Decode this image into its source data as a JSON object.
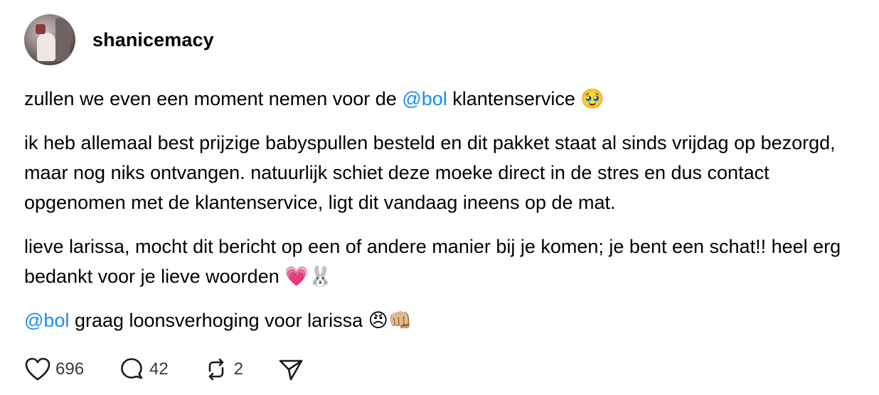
{
  "post": {
    "username": "shanicemacy",
    "paragraphs": [
      {
        "segments": [
          {
            "text": "zullen we even een moment nemen voor de ",
            "mention": false
          },
          {
            "text": "@bol",
            "mention": true
          },
          {
            "text": " klantenservice 🥹",
            "mention": false
          }
        ]
      },
      {
        "segments": [
          {
            "text": "ik heb allemaal best prijzige babyspullen besteld en dit pakket staat al sinds vrijdag op bezorgd, maar nog niks ontvangen. natuurlijk schiet deze moeke direct in de stres en dus contact opgenomen met de klantenservice, ligt dit vandaag ineens op de mat.",
            "mention": false
          }
        ]
      },
      {
        "segments": [
          {
            "text": "lieve larissa, mocht dit bericht op een of andere manier bij je komen; je bent een schat!! heel erg bedankt voor je lieve woorden 💗🐰",
            "mention": false
          }
        ]
      },
      {
        "segments": [
          {
            "text": "@bol",
            "mention": true
          },
          {
            "text": " graag loonsverhoging voor larissa 😠👊🏼",
            "mention": false
          }
        ]
      }
    ]
  },
  "actions": {
    "likes": "696",
    "comments": "42",
    "reposts": "2",
    "like_icon": "heart-icon",
    "comment_icon": "comment-bubble-icon",
    "repost_icon": "repost-icon",
    "share_icon": "send-icon"
  },
  "colors": {
    "mention": "#1a8cf0",
    "text": "#000000",
    "count": "#3a3a3a"
  }
}
